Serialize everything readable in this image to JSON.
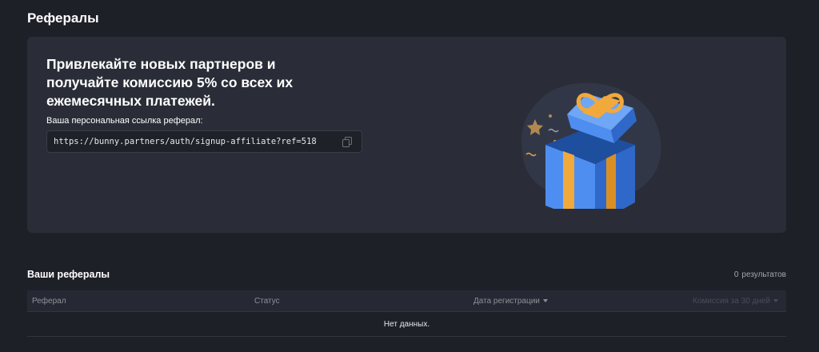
{
  "page": {
    "title": "Рефералы"
  },
  "hero": {
    "heading": "Привлекайте новых партнеров и получайте комиссию 5% со всех их ежемесячных платежей.",
    "link_label": "Ваша персональная ссылка реферал:",
    "link_value": "https://bunny.partners/auth/signup-affiliate?ref=518",
    "copy_icon": "copy-icon",
    "illustration": "gift-box-illustration"
  },
  "referrals": {
    "title": "Ваши рефералы",
    "results_count": "0",
    "results_label": "результатов",
    "columns": [
      "Реферал",
      "Статус",
      "Дата регистрации",
      "Комиссия за 30 дней"
    ],
    "empty_text": "Нет данных."
  },
  "colors": {
    "background": "#1e2028",
    "card": "#2a2d37",
    "gift_blue": "#4e8ef0",
    "gift_ribbon": "#f2a93b"
  }
}
